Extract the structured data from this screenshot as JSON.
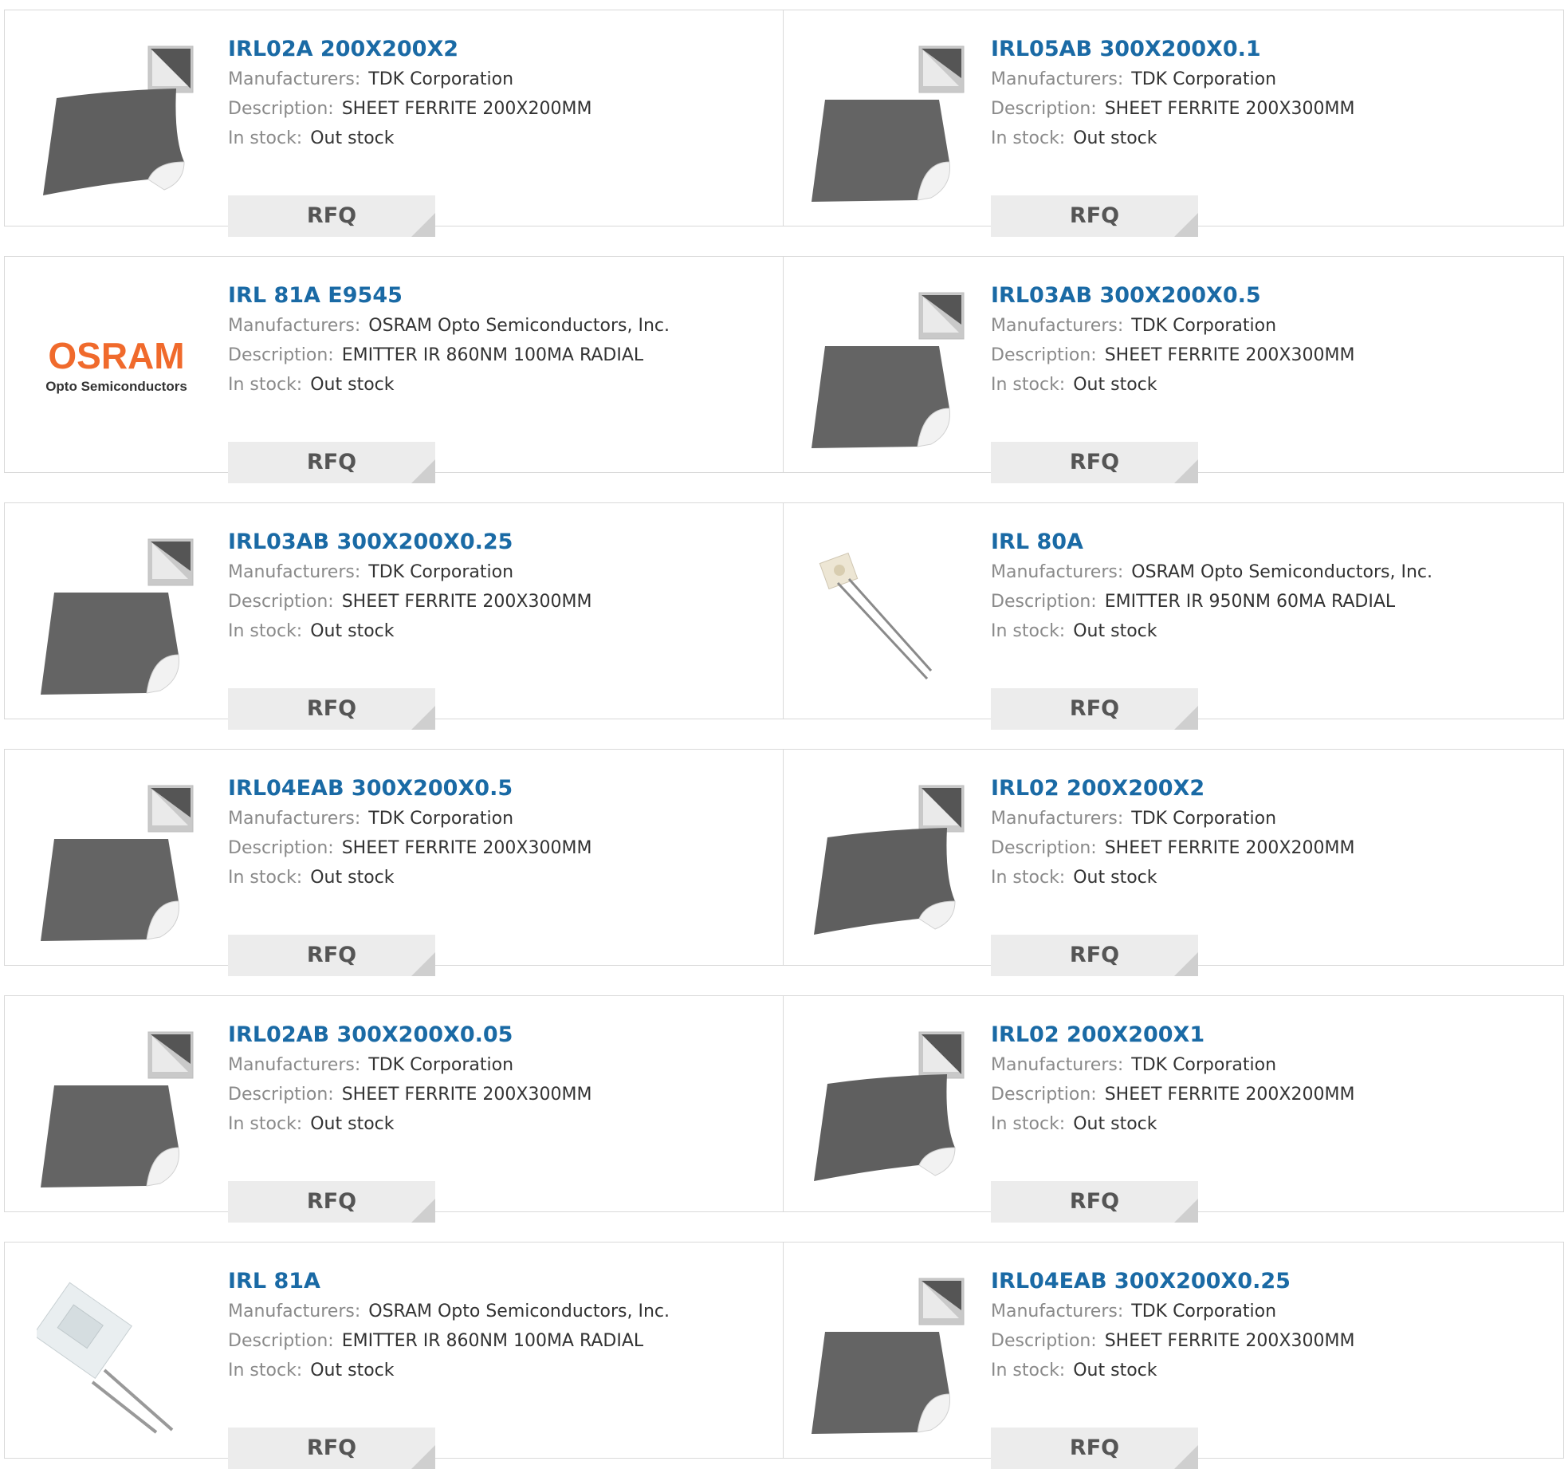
{
  "labels": {
    "manufacturers": "Manufacturers:",
    "description": "Description:",
    "in_stock": "In stock:",
    "rfq": "RFQ"
  },
  "products": [
    {
      "part": "IRL02A 200X200X2",
      "manufacturer": "TDK Corporation",
      "description": "SHEET FERRITE 200X200MM",
      "stock": "Out stock",
      "image": "ferrite-sheet-square"
    },
    {
      "part": "IRL05AB 300X200X0.1",
      "manufacturer": "TDK Corporation",
      "description": "SHEET FERRITE 200X300MM",
      "stock": "Out stock",
      "image": "ferrite-sheet-rect"
    },
    {
      "part": "IRL 81A E9545",
      "manufacturer": "OSRAM Opto Semiconductors, Inc.",
      "description": "EMITTER IR 860NM 100MA RADIAL",
      "stock": "Out stock",
      "image": "osram-logo",
      "logo_top": "OSRAM",
      "logo_bottom": "Opto Semiconductors"
    },
    {
      "part": "IRL03AB 300X200X0.5",
      "manufacturer": "TDK Corporation",
      "description": "SHEET FERRITE 200X300MM",
      "stock": "Out stock",
      "image": "ferrite-sheet-rect"
    },
    {
      "part": "IRL03AB 300X200X0.25",
      "manufacturer": "TDK Corporation",
      "description": "SHEET FERRITE 200X300MM",
      "stock": "Out stock",
      "image": "ferrite-sheet-rect"
    },
    {
      "part": "IRL 80A",
      "manufacturer": "OSRAM Opto Semiconductors, Inc.",
      "description": "EMITTER IR 950NM 60MA RADIAL",
      "stock": "Out stock",
      "image": "ir-emitter-small"
    },
    {
      "part": "IRL04EAB 300X200X0.5",
      "manufacturer": "TDK Corporation",
      "description": "SHEET FERRITE 200X300MM",
      "stock": "Out stock",
      "image": "ferrite-sheet-rect"
    },
    {
      "part": "IRL02 200X200X2",
      "manufacturer": "TDK Corporation",
      "description": "SHEET FERRITE 200X200MM",
      "stock": "Out stock",
      "image": "ferrite-sheet-square"
    },
    {
      "part": "IRL02AB 300X200X0.05",
      "manufacturer": "TDK Corporation",
      "description": "SHEET FERRITE 200X300MM",
      "stock": "Out stock",
      "image": "ferrite-sheet-rect"
    },
    {
      "part": "IRL02 200X200X1",
      "manufacturer": "TDK Corporation",
      "description": "SHEET FERRITE 200X200MM",
      "stock": "Out stock",
      "image": "ferrite-sheet-square"
    },
    {
      "part": "IRL 81A",
      "manufacturer": "OSRAM Opto Semiconductors, Inc.",
      "description": "EMITTER IR 860NM 100MA RADIAL",
      "stock": "Out stock",
      "image": "ir-emitter-large"
    },
    {
      "part": "IRL04EAB 300X200X0.25",
      "manufacturer": "TDK Corporation",
      "description": "SHEET FERRITE 200X300MM",
      "stock": "Out stock",
      "image": "ferrite-sheet-rect"
    }
  ],
  "colors": {
    "title": "#1a6aa5",
    "label": "#8a8a8a",
    "value": "#333333",
    "rfq_bg": "#ececec",
    "border": "#d9d9d9",
    "osram": "#f06a2c"
  }
}
